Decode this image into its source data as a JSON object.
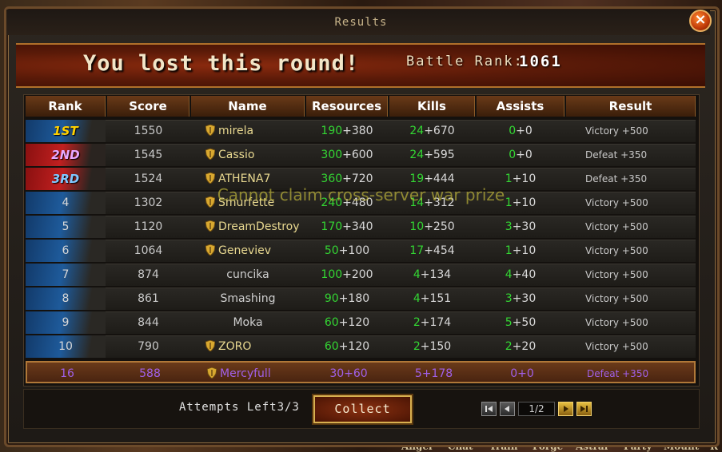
{
  "window": {
    "title": "Results"
  },
  "banner": {
    "headline": "You lost this round!",
    "rank_label": "Battle Rank:",
    "rank_value": "1061"
  },
  "columns": [
    "Rank",
    "Score",
    "Name",
    "Resources",
    "Kills",
    "Assists",
    "Result"
  ],
  "rows": [
    {
      "rank": "1ST",
      "score": "1550",
      "name": "mirela",
      "badge": true,
      "res_a": "190",
      "res_b": "+380",
      "kills_a": "24",
      "kills_b": "+670",
      "ast_a": "0",
      "ast_b": "+0",
      "result": "Victory",
      "bonus": "+500",
      "rank_color": "#ffd000",
      "stripe": "blue"
    },
    {
      "rank": "2ND",
      "score": "1545",
      "name": "Cassio",
      "badge": true,
      "res_a": "300",
      "res_b": "+600",
      "kills_a": "24",
      "kills_b": "+595",
      "ast_a": "0",
      "ast_b": "+0",
      "result": "Defeat",
      "bonus": "+350",
      "rank_color": "#e8a8ff",
      "stripe": "red"
    },
    {
      "rank": "3RD",
      "score": "1524",
      "name": "ATHENA7",
      "badge": true,
      "res_a": "360",
      "res_b": "+720",
      "kills_a": "19",
      "kills_b": "+444",
      "ast_a": "1",
      "ast_b": "+10",
      "result": "Defeat",
      "bonus": "+350",
      "rank_color": "#80c8ff",
      "stripe": "red"
    },
    {
      "rank": "4",
      "score": "1302",
      "name": "Smurfette",
      "badge": true,
      "res_a": "240",
      "res_b": "+480",
      "kills_a": "14",
      "kills_b": "+312",
      "ast_a": "1",
      "ast_b": "+10",
      "result": "Victory",
      "bonus": "+500",
      "rank_color": "#d8d8d8",
      "stripe": "blue"
    },
    {
      "rank": "5",
      "score": "1120",
      "name": "DreamDestroy",
      "badge": true,
      "res_a": "170",
      "res_b": "+340",
      "kills_a": "10",
      "kills_b": "+250",
      "ast_a": "3",
      "ast_b": "+30",
      "result": "Victory",
      "bonus": "+500",
      "rank_color": "#d8d8d8",
      "stripe": "blue"
    },
    {
      "rank": "6",
      "score": "1064",
      "name": "Geneviev",
      "badge": true,
      "res_a": "50",
      "res_b": "+100",
      "kills_a": "17",
      "kills_b": "+454",
      "ast_a": "1",
      "ast_b": "+10",
      "result": "Victory",
      "bonus": "+500",
      "rank_color": "#d8d8d8",
      "stripe": "blue"
    },
    {
      "rank": "7",
      "score": "874",
      "name": "cuncika",
      "badge": false,
      "res_a": "100",
      "res_b": "+200",
      "kills_a": "4",
      "kills_b": "+134",
      "ast_a": "4",
      "ast_b": "+40",
      "result": "Victory",
      "bonus": "+500",
      "rank_color": "#d8d8d8",
      "stripe": "blue"
    },
    {
      "rank": "8",
      "score": "861",
      "name": "Smashing",
      "badge": false,
      "res_a": "90",
      "res_b": "+180",
      "kills_a": "4",
      "kills_b": "+151",
      "ast_a": "3",
      "ast_b": "+30",
      "result": "Victory",
      "bonus": "+500",
      "rank_color": "#d8d8d8",
      "stripe": "blue"
    },
    {
      "rank": "9",
      "score": "844",
      "name": "Moka",
      "badge": false,
      "res_a": "60",
      "res_b": "+120",
      "kills_a": "2",
      "kills_b": "+174",
      "ast_a": "5",
      "ast_b": "+50",
      "result": "Victory",
      "bonus": "+500",
      "rank_color": "#d8d8d8",
      "stripe": "blue"
    },
    {
      "rank": "10",
      "score": "790",
      "name": "ZORO",
      "badge": true,
      "res_a": "60",
      "res_b": "+120",
      "kills_a": "2",
      "kills_b": "+150",
      "ast_a": "2",
      "ast_b": "+20",
      "result": "Victory",
      "bonus": "+500",
      "rank_color": "#d8d8d8",
      "stripe": "blue"
    }
  ],
  "my_row": {
    "rank": "16",
    "score": "588",
    "name": "Mercyfull",
    "badge": true,
    "res_a": "30",
    "res_b": "+60",
    "kills_a": "5",
    "kills_b": "+178",
    "ast_a": "0",
    "ast_b": "+0",
    "result": "Defeat",
    "bonus": "+350"
  },
  "overlay_message": "Cannot claim cross-server war prize",
  "footer": {
    "attempts_label": "Attempts Left",
    "attempts_value": "3/3",
    "collect_label": "Collect",
    "page": "1/2"
  },
  "bottom_menu": [
    "Angel",
    "Chat",
    "Train",
    "Forge",
    "Astral",
    "Party",
    "Mount",
    "R"
  ],
  "colors": {
    "victory_accent": "#33d633",
    "self_row_text": "#a060e8",
    "gold": "#d8b050"
  },
  "icons": [
    "close-icon",
    "guild-shield-icon",
    "first-page-icon",
    "prev-page-icon",
    "next-page-icon",
    "last-page-icon"
  ]
}
